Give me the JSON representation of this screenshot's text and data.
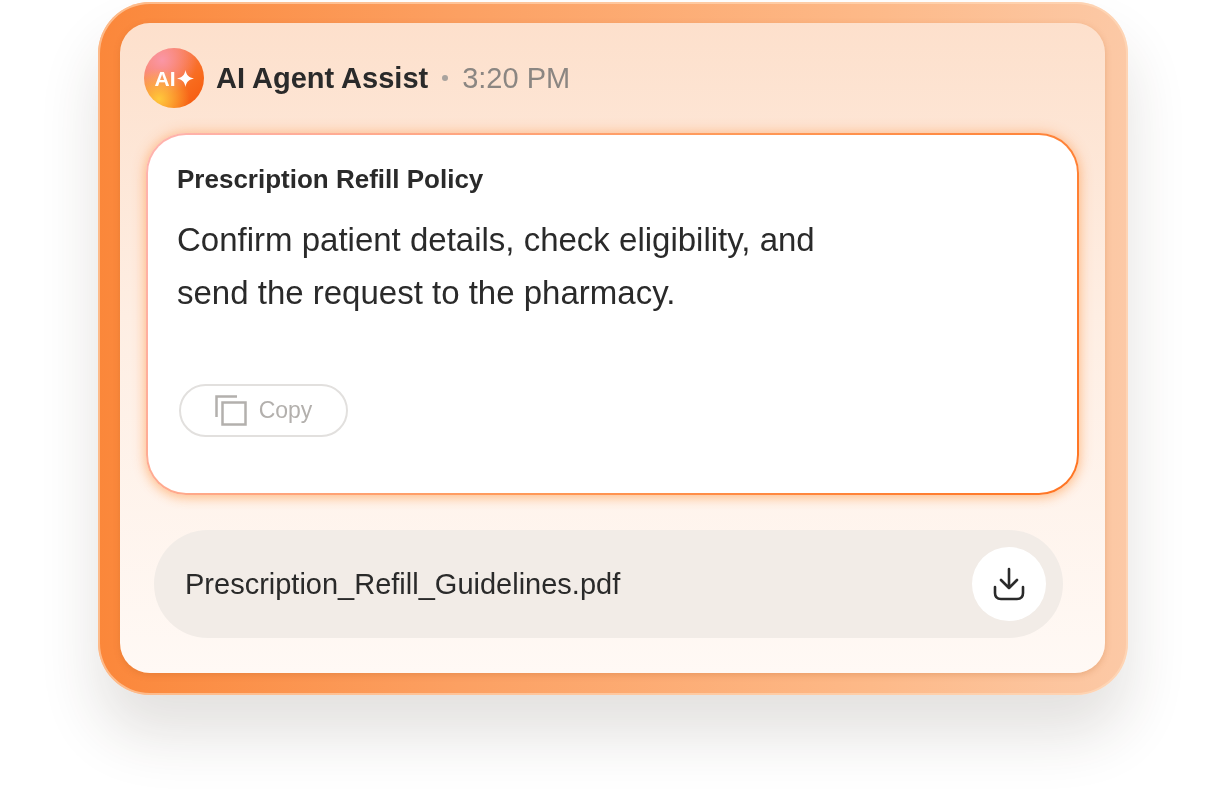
{
  "header": {
    "avatar_label": "AI",
    "name": "AI Agent Assist",
    "time": "3:20 PM"
  },
  "message": {
    "title": "Prescription Refill Policy",
    "body": "Confirm patient details, check eligibility, and send the request to the pharmacy.",
    "copy_button": "Copy"
  },
  "attachment": {
    "file_name": "Prescription_Refill_Guidelines.pdf"
  }
}
